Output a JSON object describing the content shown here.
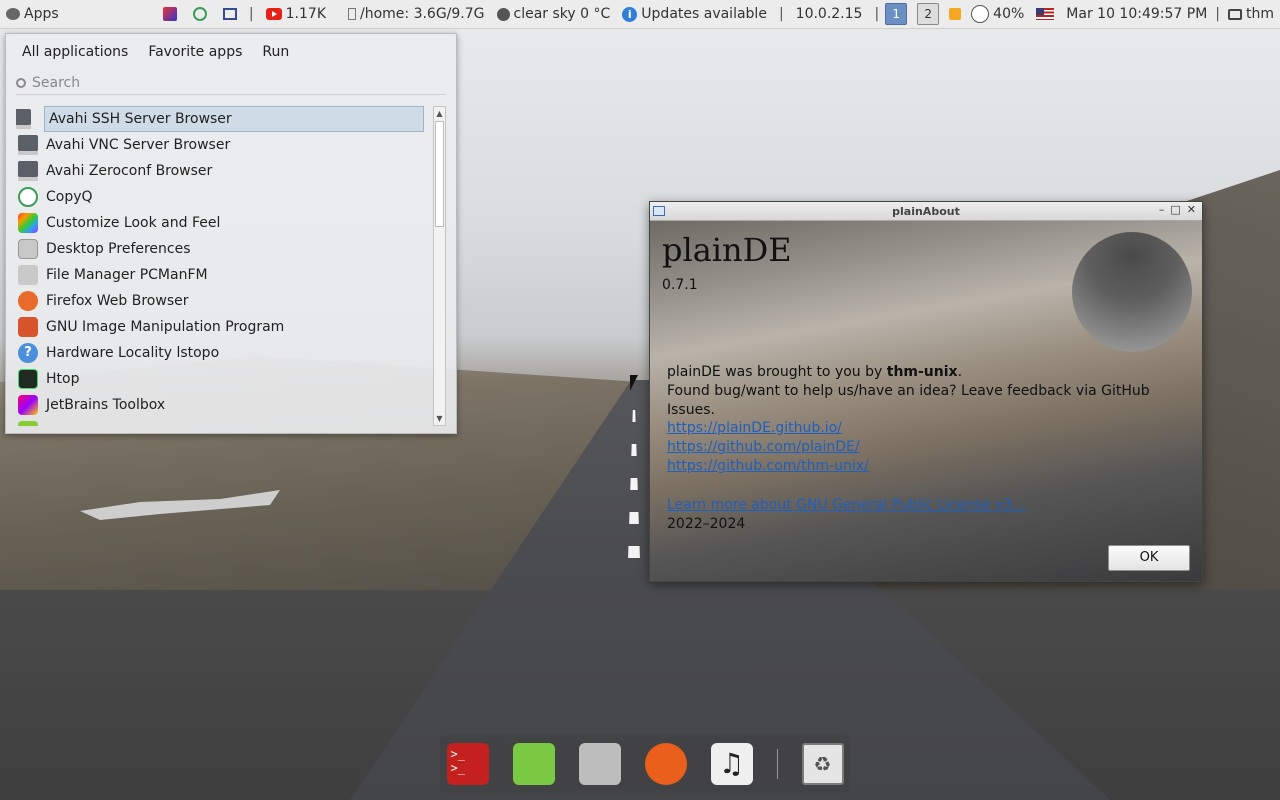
{
  "panel": {
    "apps_label": "Apps",
    "youtube_count": "1.17K",
    "disk": "/home: 3.6G/9.7G",
    "weather": "clear sky 0 °C",
    "updates": "Updates available",
    "ip": "10.0.2.15",
    "workspaces": [
      "1",
      "2"
    ],
    "battery": "40%",
    "datetime": "Mar 10 10:49:57 PM",
    "user": "thm",
    "separator": "|"
  },
  "menu": {
    "tabs": [
      "All applications",
      "Favorite apps",
      "Run"
    ],
    "search_placeholder": "Search",
    "items": [
      {
        "label": "Avahi SSH Server Browser",
        "icon": "monitor-icon"
      },
      {
        "label": "Avahi VNC Server Browser",
        "icon": "monitor-icon"
      },
      {
        "label": "Avahi Zeroconf Browser",
        "icon": "monitor-icon"
      },
      {
        "label": "CopyQ",
        "icon": "copyq-icon"
      },
      {
        "label": "Customize Look and Feel",
        "icon": "palette-icon"
      },
      {
        "label": "Desktop Preferences",
        "icon": "desktop-icon"
      },
      {
        "label": "File Manager PCManFM",
        "icon": "folder-icon"
      },
      {
        "label": "Firefox Web Browser",
        "icon": "firefox-icon"
      },
      {
        "label": "GNU Image Manipulation Program",
        "icon": "gimp-icon"
      },
      {
        "label": "Hardware Locality lstopo",
        "icon": "help-icon"
      },
      {
        "label": "Htop",
        "icon": "htop-icon"
      },
      {
        "label": "JetBrains Toolbox",
        "icon": "jetbrains-icon"
      }
    ]
  },
  "about": {
    "window_title": "plainAbout",
    "name": "plainDE",
    "version": "0.7.1",
    "credit_prefix": "plainDE was brought to you by ",
    "credit_author": "thm-unix",
    "credit_suffix": ".",
    "feedback": "Found bug/want to help us/have an idea? Leave feedback via GitHub Issues.",
    "links": [
      "https://plainDE.github.io/",
      "https://github.com/plainDE/",
      "https://github.com/thm-unix/"
    ],
    "license_link": "Learn more about GNU General Public License v3...",
    "years": "2022–2024",
    "ok_label": "OK"
  },
  "dock": {
    "items": [
      "terminal-icon",
      "notes-icon",
      "files-icon",
      "firefox-icon",
      "music-icon",
      "trash-icon"
    ]
  }
}
